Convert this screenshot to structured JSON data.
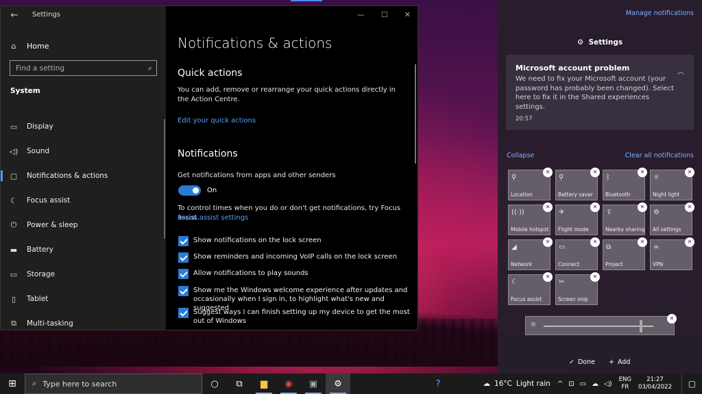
{
  "settings": {
    "app_title": "Settings",
    "home": "Home",
    "search_placeholder": "Find a setting",
    "section": "System",
    "nav": [
      {
        "label": "Display",
        "icon": "display-icon"
      },
      {
        "label": "Sound",
        "icon": "sound-icon"
      },
      {
        "label": "Notifications & actions",
        "icon": "notifications-icon"
      },
      {
        "label": "Focus assist",
        "icon": "moon-icon"
      },
      {
        "label": "Power & sleep",
        "icon": "power-icon"
      },
      {
        "label": "Battery",
        "icon": "battery-icon"
      },
      {
        "label": "Storage",
        "icon": "storage-icon"
      },
      {
        "label": "Tablet",
        "icon": "tablet-icon"
      },
      {
        "label": "Multi-tasking",
        "icon": "multitasking-icon"
      }
    ],
    "page_title": "Notifications & actions",
    "quick_actions_heading": "Quick actions",
    "quick_actions_text": "You can add, remove or rearrange your quick actions directly in the Action Centre.",
    "quick_actions_link": "Edit your quick actions",
    "notifications_heading": "Notifications",
    "get_notifications_label": "Get notifications from apps and other senders",
    "toggle_state": "On",
    "focus_text": "To control times when you do or don't get notifications, try Focus assist.",
    "focus_link": "Focus assist settings",
    "checkboxes": [
      "Show notifications on the lock screen",
      "Show reminders and incoming VoIP calls on the lock screen",
      "Allow notifications to play sounds",
      "Show me the Windows welcome experience after updates and occasionally when I sign in, to highlight what's new and suggested",
      "Suggest ways I can finish setting up my device to get the most out of Windows"
    ]
  },
  "action_centre": {
    "manage_notifications": "Manage notifications",
    "group_title": "Settings",
    "notification": {
      "title": "Microsoft account problem",
      "body": "We need to fix your Microsoft account (your password has probably been changed). Select here to fix it in the Shared experiences settings.",
      "time": "20:57"
    },
    "collapse": "Collapse",
    "clear_all": "Clear all notifications",
    "tiles": [
      {
        "label": "Location",
        "icon": "location-icon"
      },
      {
        "label": "Battery saver",
        "icon": "battery-saver-icon"
      },
      {
        "label": "Bluetooth",
        "icon": "bluetooth-icon"
      },
      {
        "label": "Night light",
        "icon": "night-light-icon"
      },
      {
        "label": "Mobile hotspot",
        "icon": "hotspot-icon"
      },
      {
        "label": "Flight mode",
        "icon": "airplane-icon"
      },
      {
        "label": "Nearby sharing",
        "icon": "nearby-sharing-icon"
      },
      {
        "label": "All settings",
        "icon": "gear-icon"
      },
      {
        "label": "Network",
        "icon": "network-icon"
      },
      {
        "label": "Connect",
        "icon": "connect-icon"
      },
      {
        "label": "Project",
        "icon": "project-icon"
      },
      {
        "label": "VPN",
        "icon": "vpn-icon"
      },
      {
        "label": "Focus assist",
        "icon": "moon-icon"
      },
      {
        "label": "Screen snip",
        "icon": "screen-snip-icon"
      }
    ],
    "done": "Done",
    "add": "Add"
  },
  "taskbar": {
    "search_placeholder": "Type here to search",
    "weather_temp": "16°C",
    "weather_desc": "Light rain",
    "lang_top": "ENG",
    "lang_bottom": "FR",
    "time": "21:27",
    "date": "03/04/2022"
  },
  "colors": {
    "accent": "#2a7bd6",
    "link": "#4fa3ff"
  }
}
